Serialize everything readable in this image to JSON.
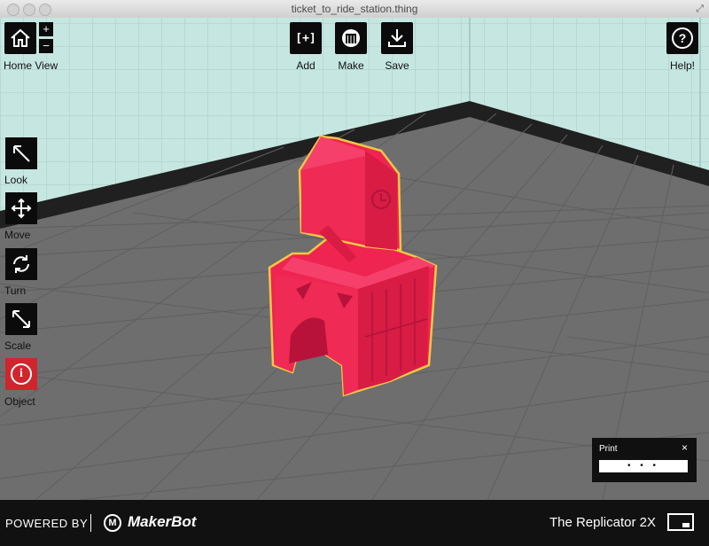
{
  "window": {
    "title": "ticket_to_ride_station.thing"
  },
  "toolbar": {
    "home_label": "Home View",
    "zoom_in": "+",
    "zoom_out": "−",
    "add_label": "Add",
    "add_glyph": "[+]",
    "make_label": "Make",
    "save_label": "Save",
    "help_label": "Help!",
    "help_glyph": "?"
  },
  "sidebar": {
    "items": [
      {
        "label": "Look",
        "icon": "look-arrow-icon"
      },
      {
        "label": "Move",
        "icon": "move-arrows-icon"
      },
      {
        "label": "Turn",
        "icon": "rotate-icon"
      },
      {
        "label": "Scale",
        "icon": "scale-arrow-icon"
      },
      {
        "label": "Object",
        "icon": "info-icon"
      }
    ],
    "active_color": "#d0252d"
  },
  "print_panel": {
    "title": "Print",
    "close": "×",
    "progress_text": "• • •"
  },
  "footer": {
    "powered_by": "POWERED BY",
    "brand": "MakerBot",
    "brand_mark": "M",
    "printer_name": "The Replicator 2X"
  },
  "colors": {
    "model": "#ef2450",
    "model_outline": "#f2c744",
    "walls": "#c6e7e1",
    "platform": "#6d6d6d",
    "toolbar": "#0b0b0b",
    "footer": "#111111"
  }
}
